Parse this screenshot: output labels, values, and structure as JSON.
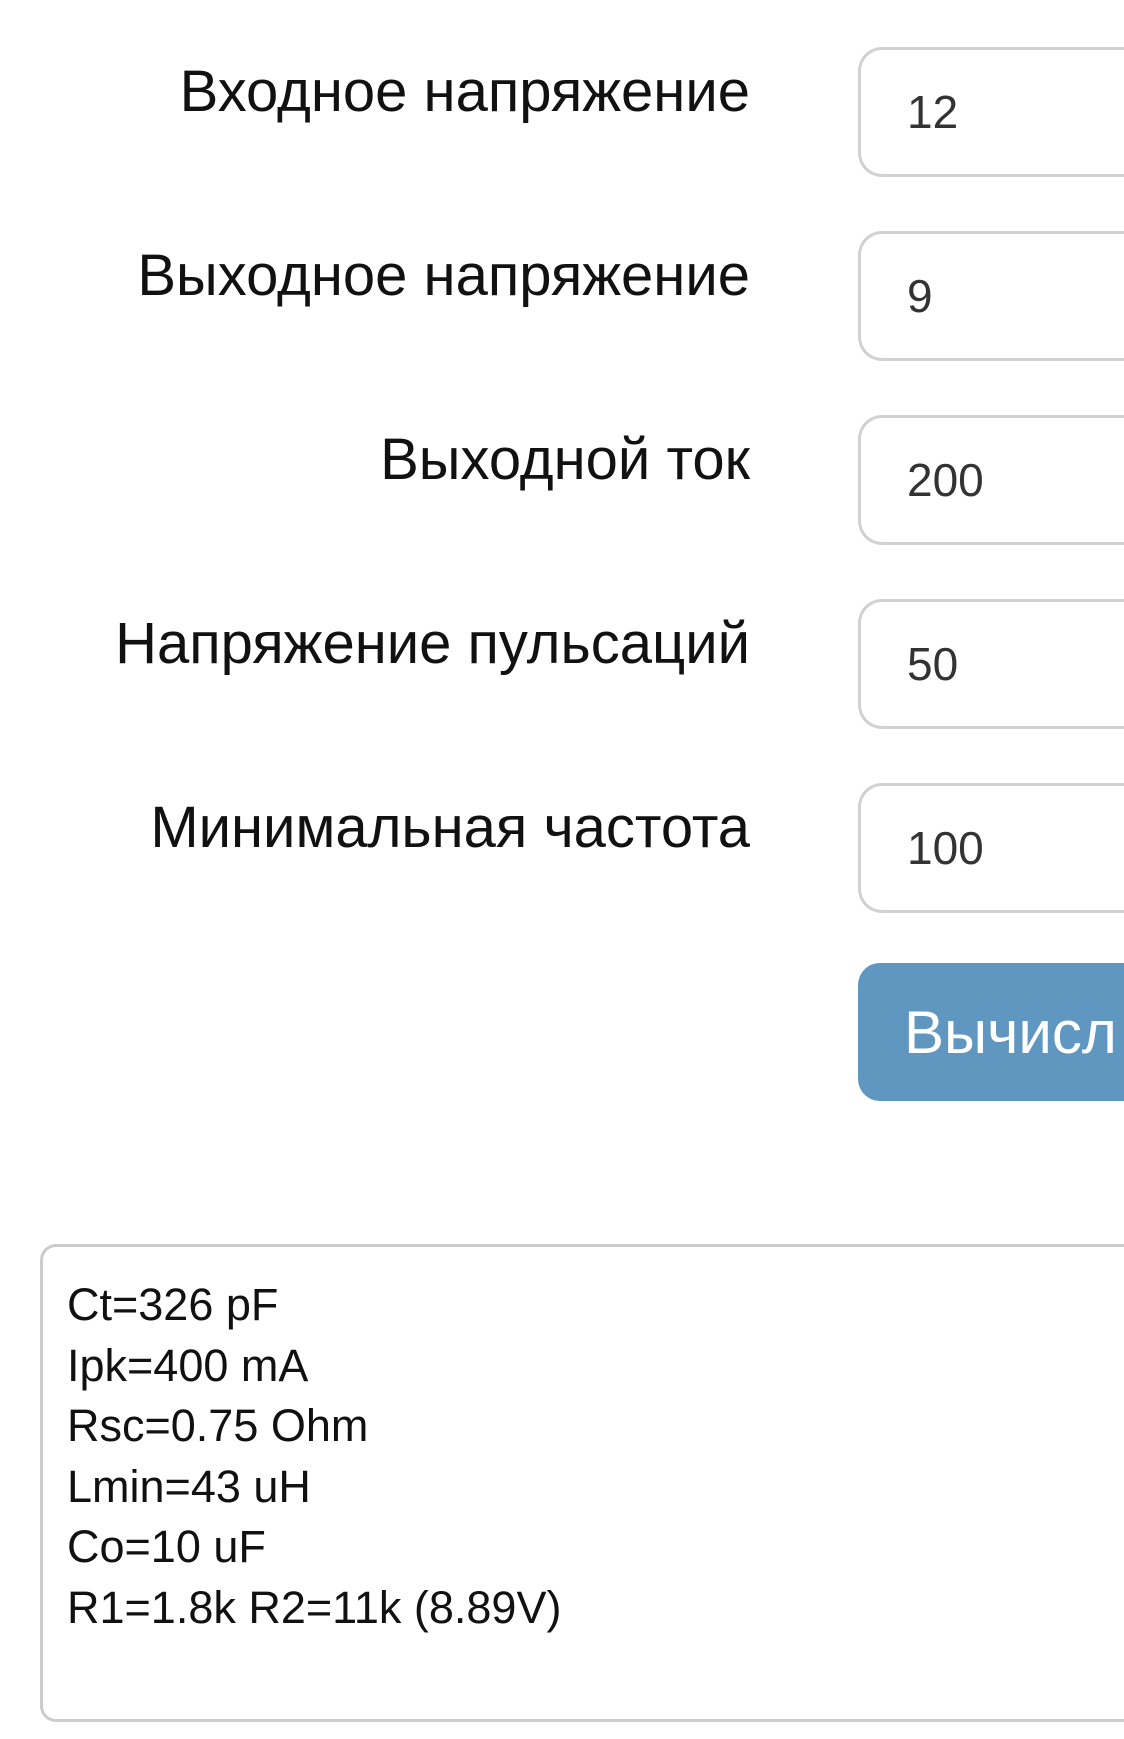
{
  "form": {
    "fields": [
      {
        "label": "Входное напряжение",
        "value": "12"
      },
      {
        "label": "Выходное напряжение",
        "value": "9"
      },
      {
        "label": "Выходной ток",
        "value": "200"
      },
      {
        "label": "Напряжение пульсаций",
        "value": "50"
      },
      {
        "label": "Минимальная частота",
        "value": "100"
      }
    ],
    "calculate_label": "Вычисл"
  },
  "result": {
    "lines": [
      "Ct=326 pF",
      "Ipk=400 mA",
      "Rsc=0.75 Ohm",
      "Lmin=43 uH",
      "Co=10 uF",
      "R1=1.8k R2=11k (8.89V)"
    ]
  },
  "colors": {
    "button_bg": "#5f97c0",
    "input_border": "#d2d2d2",
    "result_border": "#cccccc"
  }
}
